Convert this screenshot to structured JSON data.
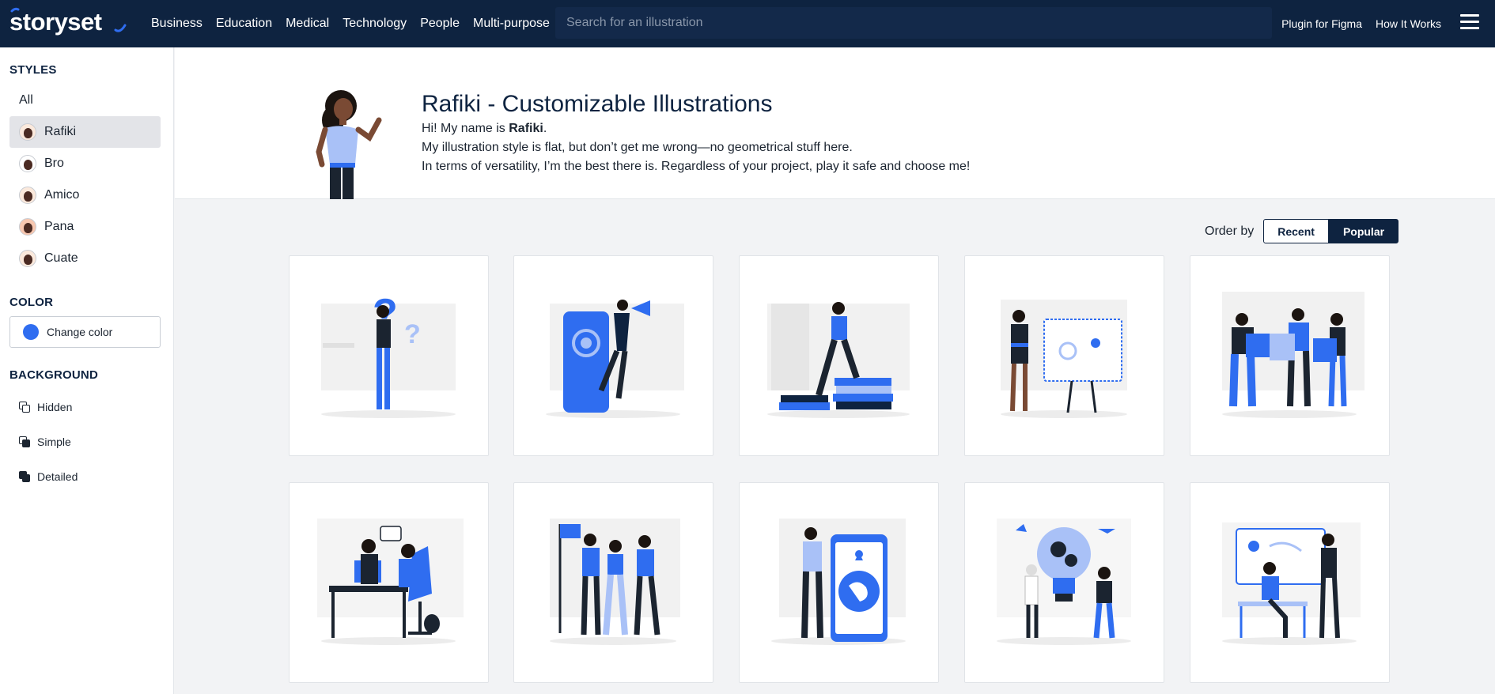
{
  "brand": {
    "name": "storyset"
  },
  "nav": {
    "items": [
      "Business",
      "Education",
      "Medical",
      "Technology",
      "People",
      "Multi-purpose"
    ]
  },
  "search": {
    "placeholder": "Search for an illustration"
  },
  "header_links": {
    "figma": "Plugin for Figma",
    "how": "How It Works"
  },
  "sidebar": {
    "styles_heading": "STYLES",
    "styles": [
      {
        "label": "All",
        "avatar": false
      },
      {
        "label": "Rafiki",
        "avatar": true,
        "active": true
      },
      {
        "label": "Bro",
        "avatar": true
      },
      {
        "label": "Amico",
        "avatar": true
      },
      {
        "label": "Pana",
        "avatar": true
      },
      {
        "label": "Cuate",
        "avatar": true
      }
    ],
    "color_heading": "COLOR",
    "color_button": "Change color",
    "color_value": "#2f6df0",
    "background_heading": "BACKGROUND",
    "backgrounds": [
      "Hidden",
      "Simple",
      "Detailed"
    ]
  },
  "hero": {
    "title": "Rafiki - Customizable Illustrations",
    "line1_prefix": "Hi! My name is ",
    "line1_name": "Rafiki",
    "line1_suffix": ".",
    "line2": "My illustration style is flat, but don’t get me wrong—no geometrical stuff here.",
    "line3": "In terms of versatility, I’m the best there is. Regardless of your project, play it safe and choose me!"
  },
  "order": {
    "label": "Order by",
    "recent": "Recent",
    "popular": "Popular",
    "selected": "Popular"
  },
  "colors": {
    "navy": "#0e2340",
    "accent": "#2f6df0",
    "light_accent": "#a9c1f7"
  },
  "cards": [
    {
      "icon": "question-marks-illustration"
    },
    {
      "icon": "megaphone-phone-illustration"
    },
    {
      "icon": "stepping-books-illustration"
    },
    {
      "icon": "presentation-board-illustration"
    },
    {
      "icon": "puzzle-team-illustration"
    },
    {
      "icon": "office-desk-chat-illustration"
    },
    {
      "icon": "team-flag-illustration"
    },
    {
      "icon": "phone-globe-illustration"
    },
    {
      "icon": "lightbulb-gears-illustration"
    },
    {
      "icon": "whiteboard-meeting-illustration"
    }
  ]
}
